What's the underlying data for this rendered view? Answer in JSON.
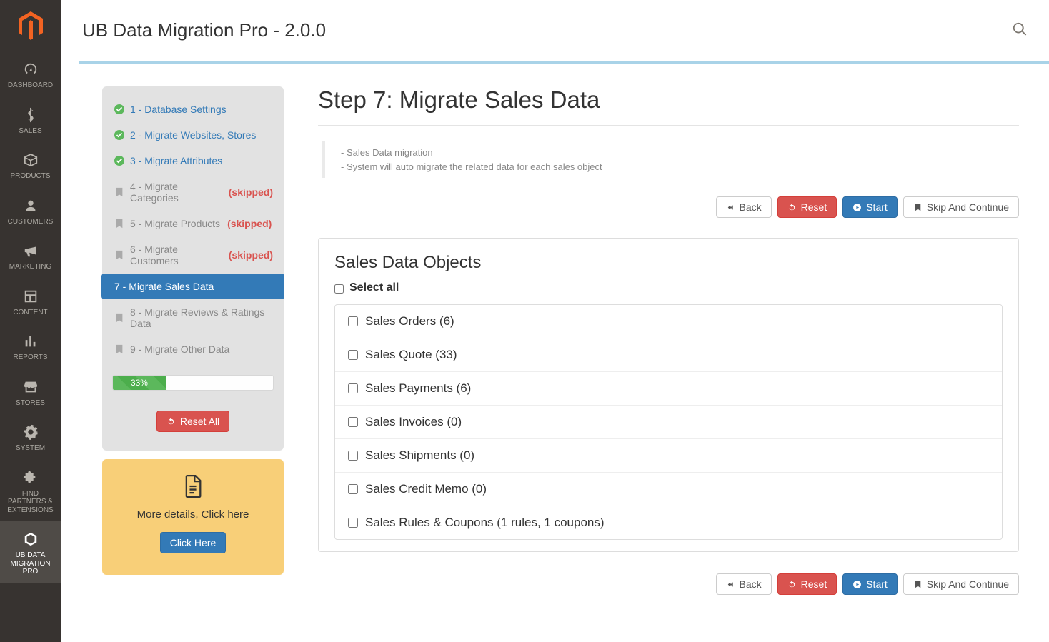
{
  "app": {
    "title": "UB Data Migration Pro - 2.0.0"
  },
  "nav": {
    "items": [
      {
        "label": "DASHBOARD"
      },
      {
        "label": "SALES"
      },
      {
        "label": "PRODUCTS"
      },
      {
        "label": "CUSTOMERS"
      },
      {
        "label": "MARKETING"
      },
      {
        "label": "CONTENT"
      },
      {
        "label": "REPORTS"
      },
      {
        "label": "STORES"
      },
      {
        "label": "SYSTEM"
      },
      {
        "label": "FIND PARTNERS & EXTENSIONS"
      },
      {
        "label": "UB DATA MIGRATION PRO"
      }
    ]
  },
  "steps": [
    {
      "text": "1 - Database Settings",
      "state": "done"
    },
    {
      "text": "2 - Migrate Websites, Stores",
      "state": "done"
    },
    {
      "text": "3 - Migrate Attributes",
      "state": "done"
    },
    {
      "text": "4 - Migrate Categories",
      "state": "skipped",
      "tag": "(skipped)"
    },
    {
      "text": "5 - Migrate Products",
      "state": "skipped",
      "tag": "(skipped)"
    },
    {
      "text": "6 - Migrate Customers",
      "state": "skipped",
      "tag": "(skipped)"
    },
    {
      "text": "7 - Migrate Sales Data",
      "state": "active"
    },
    {
      "text": "8 - Migrate Reviews & Ratings Data",
      "state": "pending"
    },
    {
      "text": "9 - Migrate Other Data",
      "state": "pending"
    }
  ],
  "progress": {
    "percent": 33,
    "label": "33%"
  },
  "reset_all_label": "Reset All",
  "details": {
    "text": "More details, Click here",
    "button": "Click Here"
  },
  "main": {
    "heading": "Step 7: Migrate Sales Data",
    "note_line1": "- Sales Data migration",
    "note_line2": "- System will auto migrate the related data for each sales object",
    "buttons": {
      "back": "Back",
      "reset": "Reset",
      "start": "Start",
      "skip": "Skip And Continue"
    },
    "panel_title": "Sales Data Objects",
    "select_all_label": "Select all",
    "objects": [
      "Sales Orders (6)",
      "Sales Quote (33)",
      "Sales Payments (6)",
      "Sales Invoices (0)",
      "Sales Shipments (0)",
      "Sales Credit Memo (0)",
      "Sales Rules & Coupons (1 rules, 1 coupons)"
    ]
  }
}
